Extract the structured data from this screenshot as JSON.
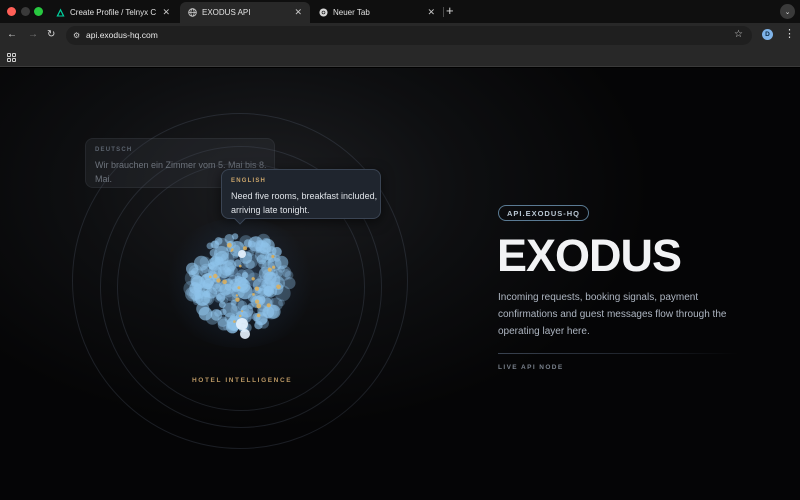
{
  "browser": {
    "tabs": [
      {
        "title": "Create Profile / Telnyx Custo",
        "icon": "telnyx-logo-icon",
        "active": false
      },
      {
        "title": "EXODUS API",
        "icon": "globe-icon",
        "active": true
      },
      {
        "title": "Neuer Tab",
        "icon": "chrome-logo-icon",
        "active": false
      }
    ],
    "new_tab_glyph": "+",
    "url": "api.exodus-hq.com",
    "profile_initial": "D"
  },
  "page": {
    "bubble_de": {
      "lang": "DEUTSCH",
      "text": "Wir brauchen ein Zimmer vom 5. Mai bis 8. Mai."
    },
    "bubble_en": {
      "lang": "ENGLISH",
      "text": "Need five rooms, breakfast included, arriving late tonight."
    },
    "orb_caption": "HOTEL INTELLIGENCE",
    "badge": "API.EXODUS-HQ",
    "title": "EXODUS",
    "description": "Incoming requests, booking signals, payment confirmations and guest messages flow through the operating layer here.",
    "node_label": "LIVE API NODE"
  },
  "colors": {
    "accent_gold": "#c9a46a",
    "orb_blue": "#8fc3ea",
    "orb_amber": "#e0b25a"
  }
}
